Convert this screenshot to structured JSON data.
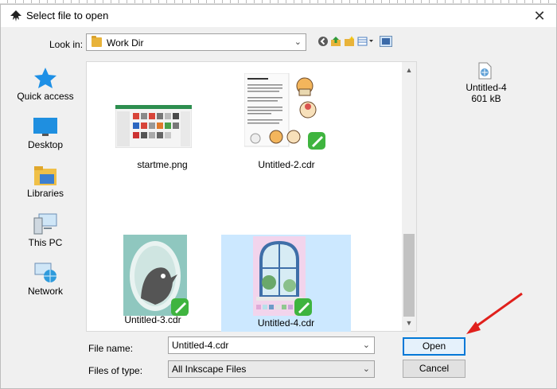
{
  "dialog": {
    "title": "Select file to open",
    "close_glyph": "✕"
  },
  "lookin": {
    "label": "Look in:",
    "value": "Work Dir",
    "arrow": "⌄"
  },
  "toolbar_icons": [
    "back-icon",
    "up-folder-icon",
    "new-folder-icon",
    "view-menu-icon",
    "preview-toggle-icon"
  ],
  "places": [
    {
      "label": "Quick access",
      "icon": "star-icon"
    },
    {
      "label": "Desktop",
      "icon": "desktop-icon"
    },
    {
      "label": "Libraries",
      "icon": "libraries-icon"
    },
    {
      "label": "This PC",
      "icon": "computer-icon"
    },
    {
      "label": "Network",
      "icon": "network-icon"
    }
  ],
  "files": [
    {
      "name": "startme.png",
      "selected": false
    },
    {
      "name": "Untitled-2.cdr",
      "selected": false
    },
    {
      "name": "Untitled-3.cdr",
      "selected": false
    },
    {
      "name": "Untitled-4.cdr",
      "selected": true
    }
  ],
  "preview": {
    "name": "Untitled-4",
    "size": "601 kB"
  },
  "filename": {
    "label": "File name:",
    "value": "Untitled-4.cdr"
  },
  "filetype": {
    "label": "Files of type:",
    "value": "All Inkscape Files"
  },
  "buttons": {
    "open": "Open",
    "cancel": "Cancel"
  },
  "scroll": {
    "up": "▲",
    "down": "▼"
  },
  "colors": {
    "selection": "#cce8ff",
    "accent": "#0078d7",
    "annotation_arrow": "#e0201c"
  }
}
